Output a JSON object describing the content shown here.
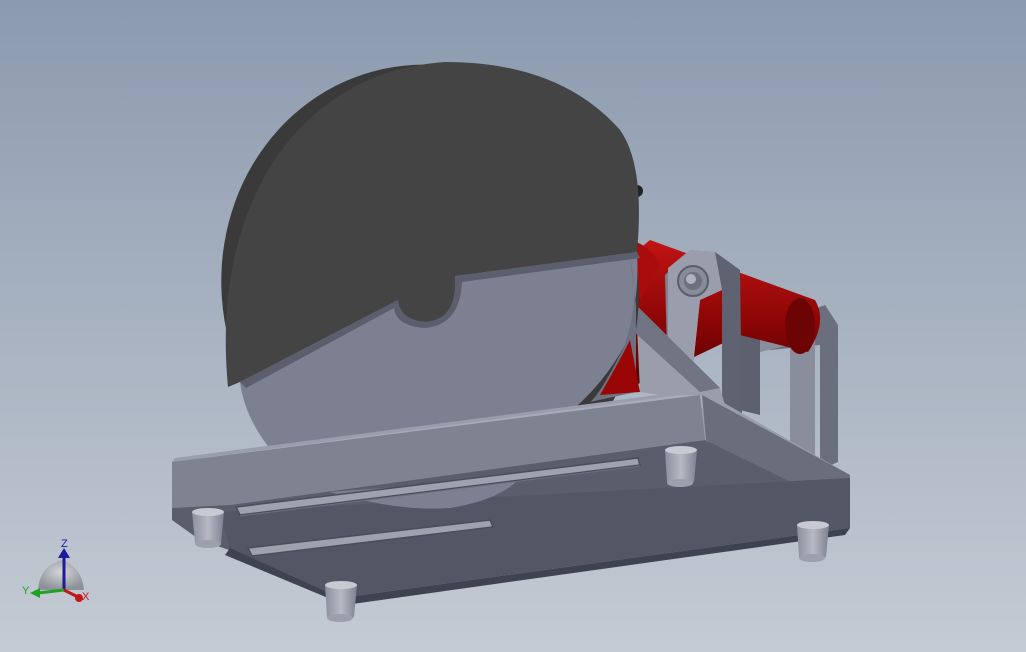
{
  "viewport": {
    "background_top": "#8c9aae",
    "background_bottom": "#c4cbd4"
  },
  "triad": {
    "z_label": "Z",
    "y_label": "Y",
    "x_label": "X",
    "z_color": "#1a1a9a",
    "y_color": "#22a022",
    "x_color": "#c01818"
  },
  "model": {
    "blade_color": "#424242",
    "guard_color": "#7c8091",
    "motor_color": "#8c0606",
    "base_color": "#5a5d6b"
  }
}
